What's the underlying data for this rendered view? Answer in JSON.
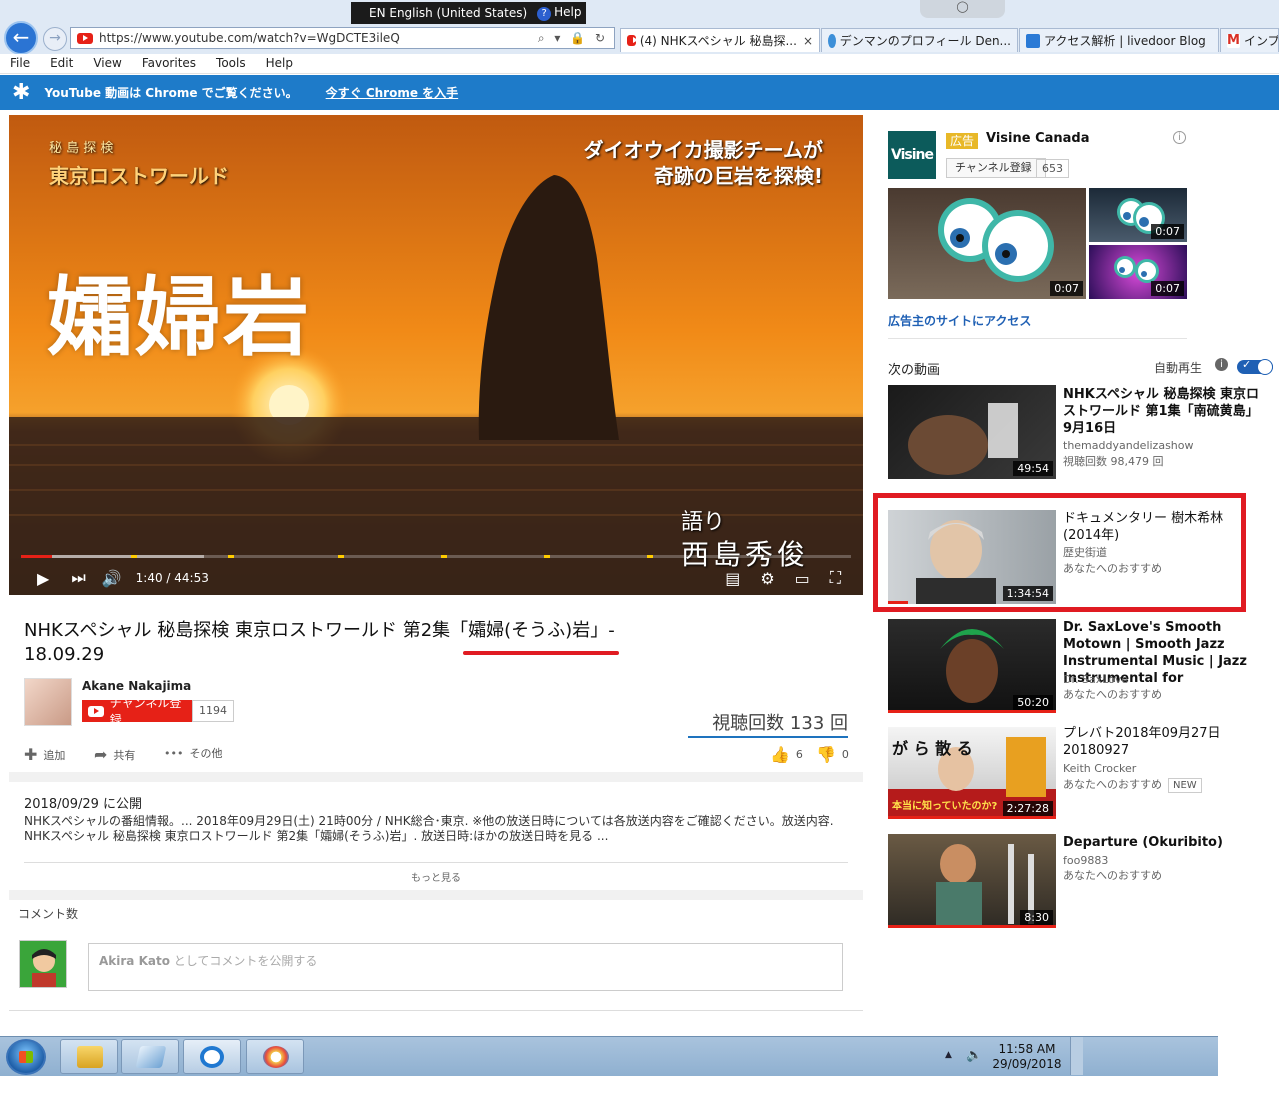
{
  "browser": {
    "language_bar": "EN English (United States)",
    "help_label": "Help",
    "help_glyph": "?",
    "url": "https://www.youtube.com/watch?v=WgDCTE3ileQ",
    "address_tools": "⌕ ▾ 🔒 ↻",
    "tabs": [
      {
        "label": "(4) NHKスペシャル 秘島探...",
        "active": true
      },
      {
        "label": "デンマンのプロフィール Den..."
      },
      {
        "label": "アクセス解析 | livedoor Blog"
      },
      {
        "label": "インプ"
      }
    ],
    "menu": [
      "File",
      "Edit",
      "View",
      "Favorites",
      "Tools",
      "Help"
    ]
  },
  "banner": {
    "icon": "✱",
    "text": "YouTube 動画は Chrome でご覧ください。",
    "link": "今すぐ Chrome を入手"
  },
  "player": {
    "overlay_main": "孀婦岩",
    "overlay_top_1": "ダイオウイカ撮影チームが",
    "overlay_top_2": "奇跡の巨岩を探検!",
    "overlay_logo_small": "秘 島 探 検",
    "overlay_logo_big": "東京ロストワールド",
    "narration_label": "語り",
    "narration_name": "西島秀俊",
    "time": "1:40 / 44:53",
    "progress": 0.037,
    "buffered": 0.22
  },
  "video": {
    "title": "NHKスペシャル 秘島探検 東京ロストワールド 第2集「孀婦(そうふ)岩」- 18.09.29",
    "channel": "Akane Nakajima",
    "subscribe": "チャンネル登録",
    "sub_count": "1194",
    "views": "視聴回数 133 回",
    "actions": {
      "add": "追加",
      "share": "共有",
      "more": "その他",
      "likes": "6",
      "dislikes": "0"
    },
    "published": "2018/09/29 に公開",
    "description": "NHKスペシャルの番組情報。... 2018年09月29日(土) 21時00分 / NHK総合･東京. ※他の放送日時については各放送内容をご確認ください。放送内容. NHKスペシャル 秘島探検 東京ロストワールド 第2集「孀婦(そうふ)岩」. 放送日時:ほかの放送日時を見る ...",
    "show_more": "もっと見る",
    "comments_header": "コメント数",
    "comment_user": "Akira Kato",
    "comment_placeholder": "としてコメントを公開する"
  },
  "ad": {
    "logo": "Visine",
    "badge": "広告",
    "name": "Visine Canada",
    "info": "i",
    "subscribe": "チャンネル登録",
    "sub_count": "653",
    "durations": [
      "0:07",
      "0:07",
      "0:07"
    ],
    "link": "広告主のサイトにアクセス"
  },
  "next": {
    "label": "次の動画",
    "autoplay": "自動再生",
    "autoplay_info": "i",
    "toggle_check": "✓",
    "items": [
      {
        "title": "NHKスペシャル 秘島探検 東京ロストワールド 第1集「南硫黄島」9月16日",
        "channel": "themaddyandelizashow",
        "meta": "視聴回数 98,479 回",
        "duration": "49:54"
      },
      {
        "title": "ドキュメンタリー 樹木希林(2014年)",
        "channel": "歴史街道",
        "meta": "あなたへのおすすめ",
        "duration": "1:34:54"
      },
      {
        "title": "Dr. SaxLove's Smooth Motown | Smooth Jazz Instrumental Music | Jazz Instrumental for",
        "channel": "Dr. SaxLove",
        "meta": "あなたへのおすすめ",
        "duration": "50:20"
      },
      {
        "title": "プレバト2018年09月27日 20180927",
        "channel": "Keith Crocker",
        "meta": "あなたへのおすすめ",
        "badge": "NEW",
        "duration": "2:27:28",
        "thumb_text_1": "が ら 散 る",
        "thumb_text_2": "本当に知っていたのか?"
      },
      {
        "title": "Departure (Okuribito)",
        "channel": "foo9883",
        "meta": "あなたへのおすすめ",
        "duration": "8:30"
      }
    ]
  },
  "taskbar": {
    "tray_arrow": "▲",
    "tray_volume": "🔈",
    "time": "11:58 AM",
    "date": "29/09/2018"
  },
  "icons": {
    "back": "←",
    "forward": "→",
    "tab_close": "×",
    "play": "▶",
    "next": "⏭",
    "volume": "🔊",
    "subtitles": "▤",
    "settings": "⚙",
    "theater": "▭",
    "fullscreen": "⛶",
    "add": "✚",
    "share": "➦",
    "more": "•••",
    "like": "👍",
    "dislike": "👎"
  },
  "colors": {
    "youtube_red": "#e62117",
    "banner_blue": "#1e7bc9",
    "link_blue": "#1f60b4",
    "highlight_red": "#e01b22"
  }
}
